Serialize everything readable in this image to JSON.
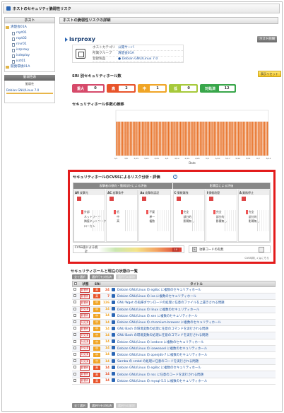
{
  "window": {
    "title": "ホストのセキュリティ脆弱性リスク"
  },
  "sidebar": {
    "header": "ホスト",
    "tree": [
      {
        "label": "清楚会01A",
        "level": 1,
        "type": "folder"
      },
      {
        "label": "rspt01",
        "level": 2,
        "type": "doc"
      },
      {
        "label": "rspt02",
        "level": 2,
        "type": "doc"
      },
      {
        "label": "rsvr01",
        "level": 2,
        "type": "doc"
      },
      {
        "label": "isrproxy",
        "level": 2,
        "type": "doc"
      },
      {
        "label": "isdeploy",
        "level": 2,
        "type": "doc"
      },
      {
        "label": "isrt01",
        "level": 2,
        "type": "doc"
      },
      {
        "label": "開発環境01A",
        "level": 1,
        "type": "folder"
      }
    ],
    "group_header": "脆弱性表",
    "group_title": "脆弱性",
    "group_row": "Debian GNU/Linux 7.0"
  },
  "main": {
    "header": "ホストの脆弱性リスクの詳細",
    "host_name": "isrproxy",
    "detail_button": "ホスト詳細",
    "info": [
      {
        "k": "ホストカテゴリ",
        "v": "公開サーバ"
      },
      {
        "k": "所属グループ",
        "v": "清楚会01A"
      },
      {
        "k": "登録製品",
        "v": "● Debian GNU/Linux 7.0"
      }
    ]
  },
  "severity": {
    "title": "SRI 別セキュリティホール数",
    "reset": "表示リセット",
    "items": [
      {
        "label": "重大",
        "count": "0",
        "color": "#d64a6a"
      },
      {
        "label": "高",
        "count": "2",
        "color": "#e8542b"
      },
      {
        "label": "中",
        "count": "1",
        "color": "#f0a526"
      },
      {
        "label": "低",
        "count": "0",
        "color": "#a6c93a"
      },
      {
        "label": "対処済",
        "count": "12",
        "color": "#38a64a"
      }
    ]
  },
  "trend": {
    "title": "セキュリティホール件数の推移",
    "xlabel": "Date"
  },
  "chart_data": {
    "type": "bar",
    "title": "セキュリティホール件数の推移",
    "xlabel": "Date",
    "ylabel": "",
    "ylim": [
      0,
      20
    ],
    "series": [
      {
        "values": [
          15,
          15,
          15,
          15,
          15,
          15,
          15,
          15,
          15,
          15,
          15,
          15,
          15,
          15,
          15,
          15,
          15,
          15,
          15,
          15,
          15,
          15,
          15,
          15,
          15,
          15,
          15,
          15,
          15,
          15,
          15,
          15,
          15,
          15,
          15,
          15,
          15,
          15,
          15,
          15,
          15,
          15,
          15,
          15,
          15,
          15,
          15,
          15,
          15,
          15,
          15,
          15,
          15,
          15,
          15,
          15,
          15,
          15,
          15,
          15,
          15,
          15,
          15,
          15,
          15,
          15,
          15,
          15,
          15,
          15,
          15,
          15,
          15,
          15,
          15,
          15,
          15,
          15,
          15,
          15,
          15,
          15,
          15,
          15,
          15,
          15,
          15,
          15,
          15,
          15,
          15,
          15,
          15,
          15,
          15,
          15,
          15,
          15,
          15,
          15
        ]
      }
    ],
    "x_ticks": [
      "3/1",
      "3/8",
      "3/15",
      "3/22",
      "3/29",
      "4/5",
      "4/12",
      "4/19",
      "4/26",
      "5/3",
      "5/10",
      "5/17",
      "5/24",
      "5/31",
      "6/7",
      "6/14"
    ]
  },
  "risk": {
    "title": "セキュリティホールのCVSSによるリスク分析・評価",
    "group_left": "攻撃者の傾向・脆弱部分による評価",
    "group_right": "影響度による評価",
    "columns": [
      {
        "code": "AV",
        "name": "攻撃元",
        "levels": [
          "外部",
          "ネットワーク",
          "隣接ネットワーク",
          "ローカル"
        ]
      },
      {
        "code": "AC",
        "name": "攻撃条件",
        "levels": [
          "低",
          "中",
          "高"
        ]
      },
      {
        "code": "Au",
        "name": "攻撃前認証",
        "levels": [
          "不要",
          "単一",
          "複数"
        ]
      },
      {
        "code": "C",
        "name": "情報漏洩",
        "levels": [
          "完全",
          "部分的",
          "影響無し"
        ]
      },
      {
        "code": "I",
        "name": "情報改竄",
        "levels": [
          "完全",
          "部分的",
          "影響無し"
        ]
      },
      {
        "code": "A",
        "name": "業務停止",
        "levels": [
          "完全",
          "部分的",
          "影響無し"
        ]
      }
    ],
    "cvss_label": "CVSS値による統計",
    "cvss_value": "10",
    "exploit_code": "E",
    "exploit_label": "攻撃コードの有無",
    "note": "CVSS詳しくはこちら"
  },
  "list": {
    "title": "セキュリティホールと現在の状態の一覧",
    "tools": [
      "全て選択",
      "選択行を対処済",
      "選択行の解除"
    ],
    "headers": {
      "check": "",
      "status": "状態",
      "sev": "SRI",
      "score": "",
      "title": "タイトル"
    },
    "rows": [
      {
        "status": "影響有",
        "sev": "高",
        "sevc": "#e8542b",
        "score": "24",
        "title": "Debian GNU/Linux の eglibc に複数のセキュリティホール"
      },
      {
        "status": "影響有",
        "sev": "高",
        "sevc": "#e8542b",
        "score": "7",
        "title": "Debian GNU/Linux の ica に複数のセキュリティホール"
      },
      {
        "status": "影響有",
        "sev": "中",
        "sevc": "#f0a526",
        "score": "126",
        "title": "GNU Wget の再帰ダウンロードの処理に任意のファイルを上書きされる問題"
      },
      {
        "status": "対処済",
        "sev": "中",
        "sevc": "#f0a526",
        "score": "14",
        "title": "Debian GNU/Linux の linux に複数のセキュリティホール"
      },
      {
        "status": "影響有",
        "sev": "中",
        "sevc": "#f0a526",
        "score": "14",
        "title": "Debian GNU/Linux の xen に複数のセキュリティホール"
      },
      {
        "status": "対処済",
        "sev": "中",
        "sevc": "#f0a526",
        "score": "14",
        "title": "Debian GNU/Linux の chromium-browser に複数のセキュリティホール"
      },
      {
        "status": "影響有",
        "sev": "中",
        "sevc": "#f0a526",
        "score": "14",
        "title": "GNU Bash の環境変数の処理に任意のコマンドを実行される問題"
      },
      {
        "status": "対処済",
        "sev": "中",
        "sevc": "#f0a526",
        "score": "14",
        "title": "GNU Bash の環境変数の処理に任意のコマンドを実行される問題"
      },
      {
        "status": "対処済",
        "sev": "中",
        "sevc": "#f0a526",
        "score": "14",
        "title": "Debian GNU/Linux の icedove に複数のセキュリティホール"
      },
      {
        "status": "対処済",
        "sev": "中",
        "sevc": "#f0a526",
        "score": "14",
        "title": "Debian GNU/Linux の iceweasel に複数のセキュリティホール"
      },
      {
        "status": "対処済",
        "sev": "中",
        "sevc": "#f0a526",
        "score": "14",
        "title": "Debian GNU/Linux の openjdk-7 に複数のセキュリティホール"
      },
      {
        "status": "対処済",
        "sev": "中",
        "sevc": "#f0a526",
        "score": "14",
        "title": "Samba の smbd の処理に任意のコードを実行される問題"
      },
      {
        "status": "影響有",
        "sev": "高",
        "sevc": "#e8542b",
        "score": "14",
        "title": "Debian GNU/Linux の eglibc に複数のセキュリティホール"
      },
      {
        "status": "影響有",
        "sev": "高",
        "sevc": "#e8542b",
        "score": "14",
        "title": "Debian GNU/Linux の nss に任意のコードを実行される問題"
      },
      {
        "status": "影響有",
        "sev": "高",
        "sevc": "#e8542b",
        "score": "14",
        "title": "Debian GNU/Linux の mysql-5.5 に複数のセキュリティホール"
      }
    ]
  }
}
